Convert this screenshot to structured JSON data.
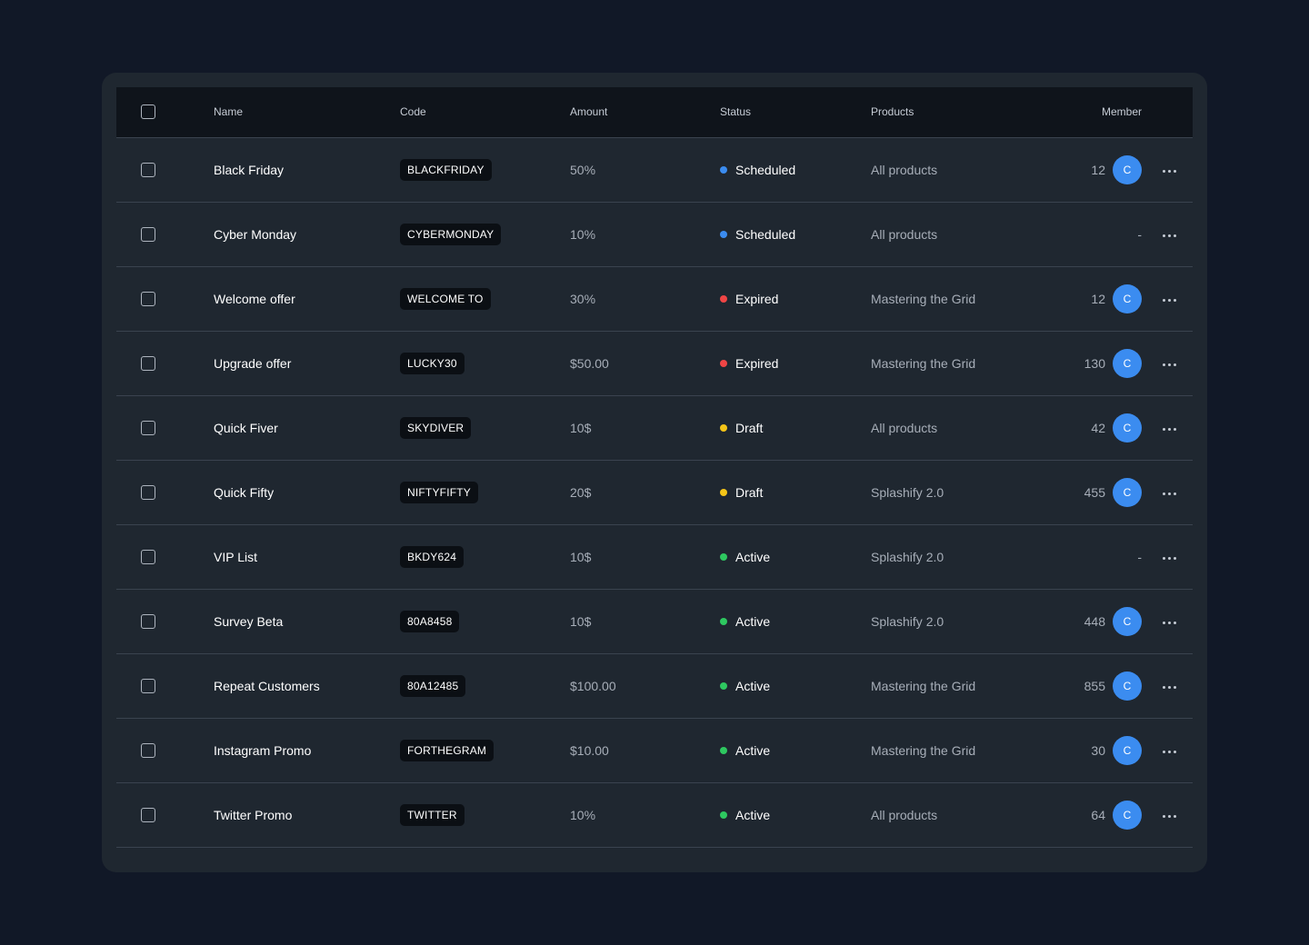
{
  "headers": {
    "name": "Name",
    "code": "Code",
    "amount": "Amount",
    "status": "Status",
    "products": "Products",
    "member": "Member"
  },
  "colors": {
    "scheduled": "#3b8cf0",
    "expired": "#f04545",
    "draft": "#f5c518",
    "active": "#2ec860",
    "avatar": "#3b8cf0"
  },
  "rows": [
    {
      "name": "Black Friday",
      "code": "BLACKFRIDAY",
      "amount": "50%",
      "status": "Scheduled",
      "status_key": "scheduled",
      "products": "All products",
      "member_count": "12",
      "avatar": "C"
    },
    {
      "name": "Cyber Monday",
      "code": "CYBERMONDAY",
      "amount": "10%",
      "status": "Scheduled",
      "status_key": "scheduled",
      "products": "All products",
      "member_count": "-",
      "avatar": ""
    },
    {
      "name": "Welcome offer",
      "code": "WELCOME TO",
      "amount": "30%",
      "status": "Expired",
      "status_key": "expired",
      "products": "Mastering the Grid",
      "member_count": "12",
      "avatar": "C"
    },
    {
      "name": "Upgrade offer",
      "code": "LUCKY30",
      "amount": "$50.00",
      "status": "Expired",
      "status_key": "expired",
      "products": "Mastering the Grid",
      "member_count": "130",
      "avatar": "C"
    },
    {
      "name": "Quick Fiver",
      "code": "SKYDIVER",
      "amount": "10$",
      "status": "Draft",
      "status_key": "draft",
      "products": "All products",
      "member_count": "42",
      "avatar": "C"
    },
    {
      "name": "Quick Fifty",
      "code": "NIFTYFIFTY",
      "amount": "20$",
      "status": "Draft",
      "status_key": "draft",
      "products": "Splashify 2.0",
      "member_count": "455",
      "avatar": "C"
    },
    {
      "name": "VIP List",
      "code": "BKDY624",
      "amount": "10$",
      "status": "Active",
      "status_key": "active",
      "products": "Splashify 2.0",
      "member_count": "-",
      "avatar": ""
    },
    {
      "name": "Survey Beta",
      "code": "80A8458",
      "amount": "10$",
      "status": "Active",
      "status_key": "active",
      "products": "Splashify 2.0",
      "member_count": "448",
      "avatar": "C"
    },
    {
      "name": "Repeat Customers",
      "code": "80A12485",
      "amount": "$100.00",
      "status": "Active",
      "status_key": "active",
      "products": "Mastering the Grid",
      "member_count": "855",
      "avatar": "C"
    },
    {
      "name": "Instagram Promo",
      "code": "FORTHEGRAM",
      "amount": "$10.00",
      "status": "Active",
      "status_key": "active",
      "products": "Mastering the Grid",
      "member_count": "30",
      "avatar": "C"
    },
    {
      "name": "Twitter Promo",
      "code": "TWITTER",
      "amount": "10%",
      "status": "Active",
      "status_key": "active",
      "products": "All products",
      "member_count": "64",
      "avatar": "C"
    }
  ]
}
